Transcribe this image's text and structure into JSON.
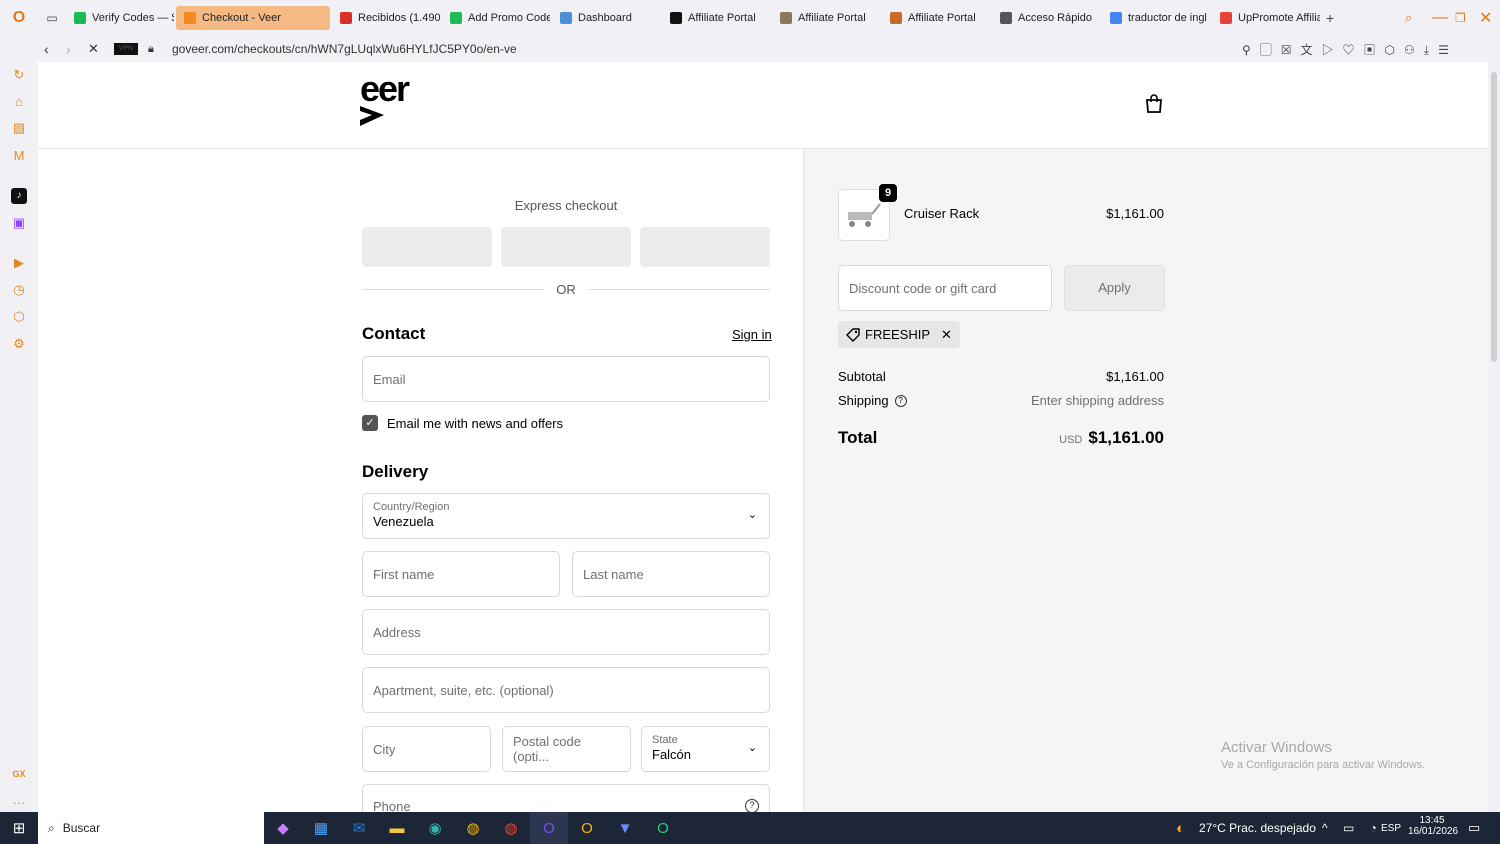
{
  "browser": {
    "tabs": [
      {
        "label": "Verify Codes — $",
        "color": "#1db954"
      },
      {
        "label": "Checkout - Veer",
        "color": "#f08a1e",
        "active": true
      },
      {
        "label": "Recibidos (1.490",
        "color": "#d93025"
      },
      {
        "label": "Add Promo Code",
        "color": "#1db954"
      },
      {
        "label": "Dashboard",
        "color": "#4a90d9"
      },
      {
        "label": "Affiliate Portal",
        "color": "#111111"
      },
      {
        "label": "Affiliate Portal",
        "color": "#8a7a5a"
      },
      {
        "label": "Affiliate Portal",
        "color": "#c86a2a"
      },
      {
        "label": "Acceso Rápido",
        "color": "#555555"
      },
      {
        "label": "traductor de ingl",
        "color": "#4285f4"
      },
      {
        "label": "UpPromote Affilia",
        "color": "#e8403a"
      }
    ],
    "url": "goveer.com/checkouts/cn/hWN7gLUqlxWu6HYLfJC5PY0o/en-ve",
    "vpn_label": "VPN"
  },
  "store": {
    "logo": "eer"
  },
  "express": {
    "title": "Express checkout",
    "or": "OR"
  },
  "contact": {
    "title": "Contact",
    "sign_in": "Sign in",
    "email_placeholder": "Email",
    "news_label": "Email me with news and offers"
  },
  "delivery": {
    "title": "Delivery",
    "country_label": "Country/Region",
    "country_value": "Venezuela",
    "first_name": "First name",
    "last_name": "Last name",
    "address": "Address",
    "apartment": "Apartment, suite, etc. (optional)",
    "city": "City",
    "postal": "Postal code (opti...",
    "state_label": "State",
    "state_value": "Falcón",
    "phone": "Phone"
  },
  "order": {
    "item_name": "Cruiser Rack",
    "item_qty": "9",
    "item_price": "$1,161.00",
    "discount_placeholder": "Discount code or gift card",
    "apply": "Apply",
    "code": "FREESHIP",
    "subtotal_label": "Subtotal",
    "subtotal_value": "$1,161.00",
    "shipping_label": "Shipping",
    "shipping_value": "Enter shipping address",
    "total_label": "Total",
    "currency": "USD",
    "total_value": "$1,161.00"
  },
  "watermark": {
    "title": "Activar Windows",
    "sub": "Ve a Configuración para activar Windows."
  },
  "taskbar": {
    "search": "Buscar",
    "weather": "27°C  Prac. despejado",
    "lang": "ESP",
    "time": "13:45",
    "date": "16/01/2026"
  }
}
